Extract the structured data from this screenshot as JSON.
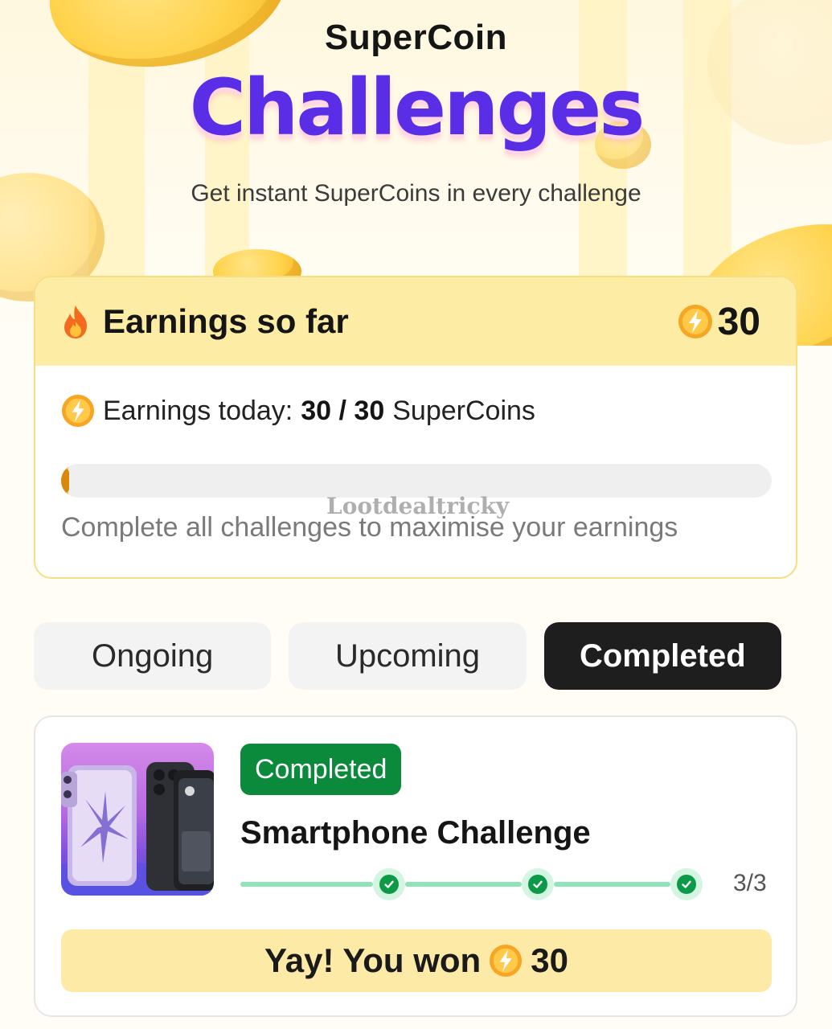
{
  "hero": {
    "title_small": "SuperCoin",
    "title_big": "Challenges",
    "subtitle": "Get instant SuperCoins in every challenge"
  },
  "earnings": {
    "title": "Earnings so far",
    "total": "30",
    "today_label": "Earnings today:",
    "today_value": "30 / 30",
    "today_unit": "SuperCoins",
    "progress_fraction": 0.01,
    "hint": "Complete all challenges to maximise your earnings",
    "watermark": "Lootdealtricky"
  },
  "tabs": [
    {
      "label": "Ongoing",
      "active": false
    },
    {
      "label": "Upcoming",
      "active": false
    },
    {
      "label": "Completed",
      "active": true
    }
  ],
  "challenge": {
    "status": "Completed",
    "title": "Smartphone Challenge",
    "steps_done": 3,
    "steps_total": 3,
    "step_count": "3/3",
    "won_text": "Yay! You won",
    "won_amount": "30"
  },
  "icons": {
    "fire": "fire-icon",
    "coin": "supercoin-icon",
    "check": "check-icon"
  },
  "colors": {
    "accent_purple": "#5a2ee6",
    "header_yellow": "#fdeca4",
    "success_green": "#0b8a3c",
    "active_tab": "#1e1e1e"
  }
}
